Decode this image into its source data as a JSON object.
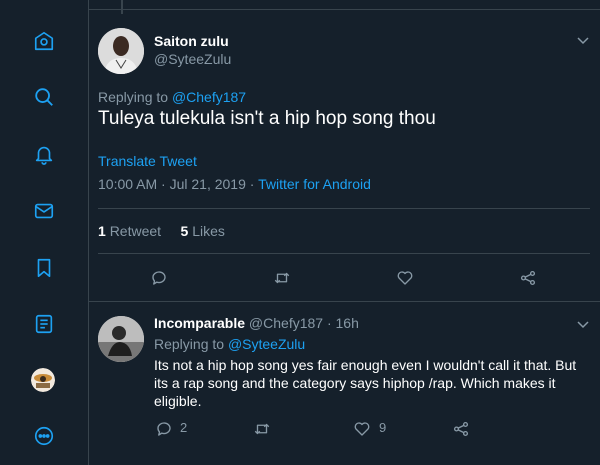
{
  "colors": {
    "bg": "#15202b",
    "border": "#38444d",
    "accent": "#1da1f2",
    "muted": "#8899a6",
    "text": "#ffffff"
  },
  "sidebar": {
    "icons": [
      "home-icon",
      "search-icon",
      "notifications-icon",
      "messages-icon",
      "bookmarks-icon",
      "lists-icon",
      "profile-avatar",
      "more-icon"
    ]
  },
  "main_tweet": {
    "name": "Saiton zulu",
    "handle": "@SyteeZulu",
    "replying_prefix": "Replying to",
    "replying_to": "@Chefy187",
    "text": "Tuleya tulekula isn't a hip hop song thou",
    "translate": "Translate Tweet",
    "timestamp": "10:00 AM · Jul 21, 2019 · ",
    "source": "Twitter for Android",
    "retweets_count": "1",
    "retweets_label": "Retweet",
    "likes_count": "5",
    "likes_label": "Likes"
  },
  "reply": {
    "name": "Incomparable",
    "handle": "@Chefy187 · 16h",
    "replying_prefix": "Replying to",
    "replying_to": "@SyteeZulu",
    "text": "Its not a hip hop song yes fair enough even I wouldn't call it that.  But its a rap song and the category says hiphop /rap.  Which makes it eligible.",
    "reply_count": "2",
    "like_count": "9"
  }
}
